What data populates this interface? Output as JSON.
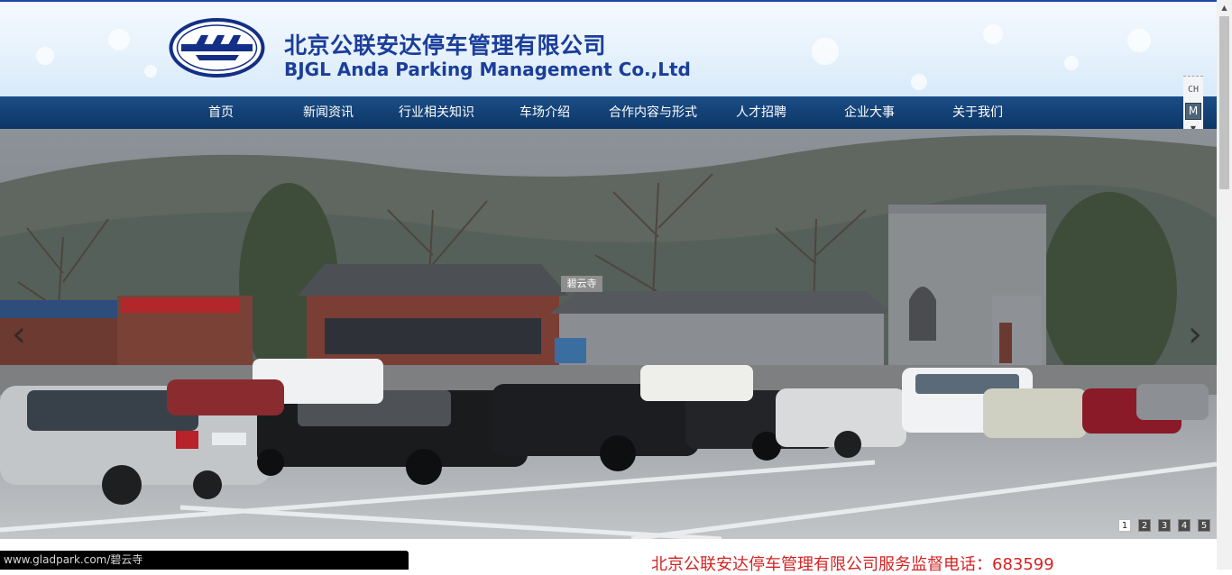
{
  "header": {
    "company_cn": "北京公联安达停车管理有限公司",
    "company_en": "BJGL Anda Parking Management Co.,Ltd",
    "logo_icon": "company-logo-icon"
  },
  "nav": {
    "items": [
      {
        "label": "首页"
      },
      {
        "label": "新闻资讯"
      },
      {
        "label": "行业相关知识"
      },
      {
        "label": "车场介绍"
      },
      {
        "label": "合作内容与形式"
      },
      {
        "label": "人才招聘"
      },
      {
        "label": "企业大事"
      },
      {
        "label": "关于我们"
      }
    ]
  },
  "language": {
    "code": "CH",
    "button": "M"
  },
  "banner": {
    "scene_label": "碧云寺",
    "prev_icon": "chevron-left-icon",
    "next_icon": "chevron-right-icon",
    "pages": [
      "1",
      "2",
      "3",
      "4",
      "5"
    ],
    "active_page": "1"
  },
  "status": {
    "url": "www.gladpark.com/碧云寺"
  },
  "footer": {
    "hotline": "北京公联安达停车管理有限公司服务监督电话：683599"
  },
  "colors": {
    "brand_blue": "#1b3e9a",
    "nav_bg": "#0f3a6b",
    "hotline_red": "#d42323"
  }
}
